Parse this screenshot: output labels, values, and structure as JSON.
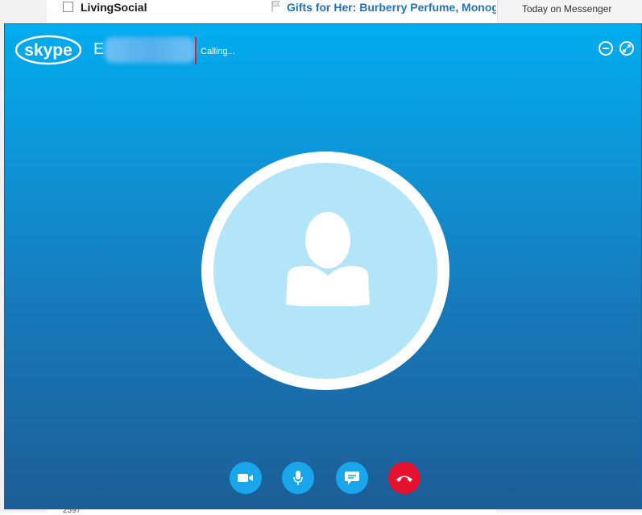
{
  "background_page": {
    "email_row": {
      "sender": "LivingSocial",
      "subject": "Gifts for Her: Burberry Perfume, Monogram"
    },
    "right_panel": {
      "title": "Today on Messenger"
    },
    "bottom_text": "2597"
  },
  "skype": {
    "logo": "skype",
    "contact_initial": "E",
    "call_status": "Calling...",
    "window_controls": [
      "minimize-icon",
      "expand-icon"
    ],
    "controls": [
      {
        "name": "video-button",
        "icon": "video-camera-icon"
      },
      {
        "name": "mic-button",
        "icon": "microphone-icon"
      },
      {
        "name": "chat-button",
        "icon": "chat-bubble-icon"
      },
      {
        "name": "hangup-button",
        "icon": "hang-up-phone-icon",
        "color": "#e4122f"
      }
    ],
    "colors": {
      "accent": "#01adef",
      "button": "#1aa6ea",
      "hangup": "#e4122f",
      "avatar_fill": "#b3e5f9"
    }
  }
}
